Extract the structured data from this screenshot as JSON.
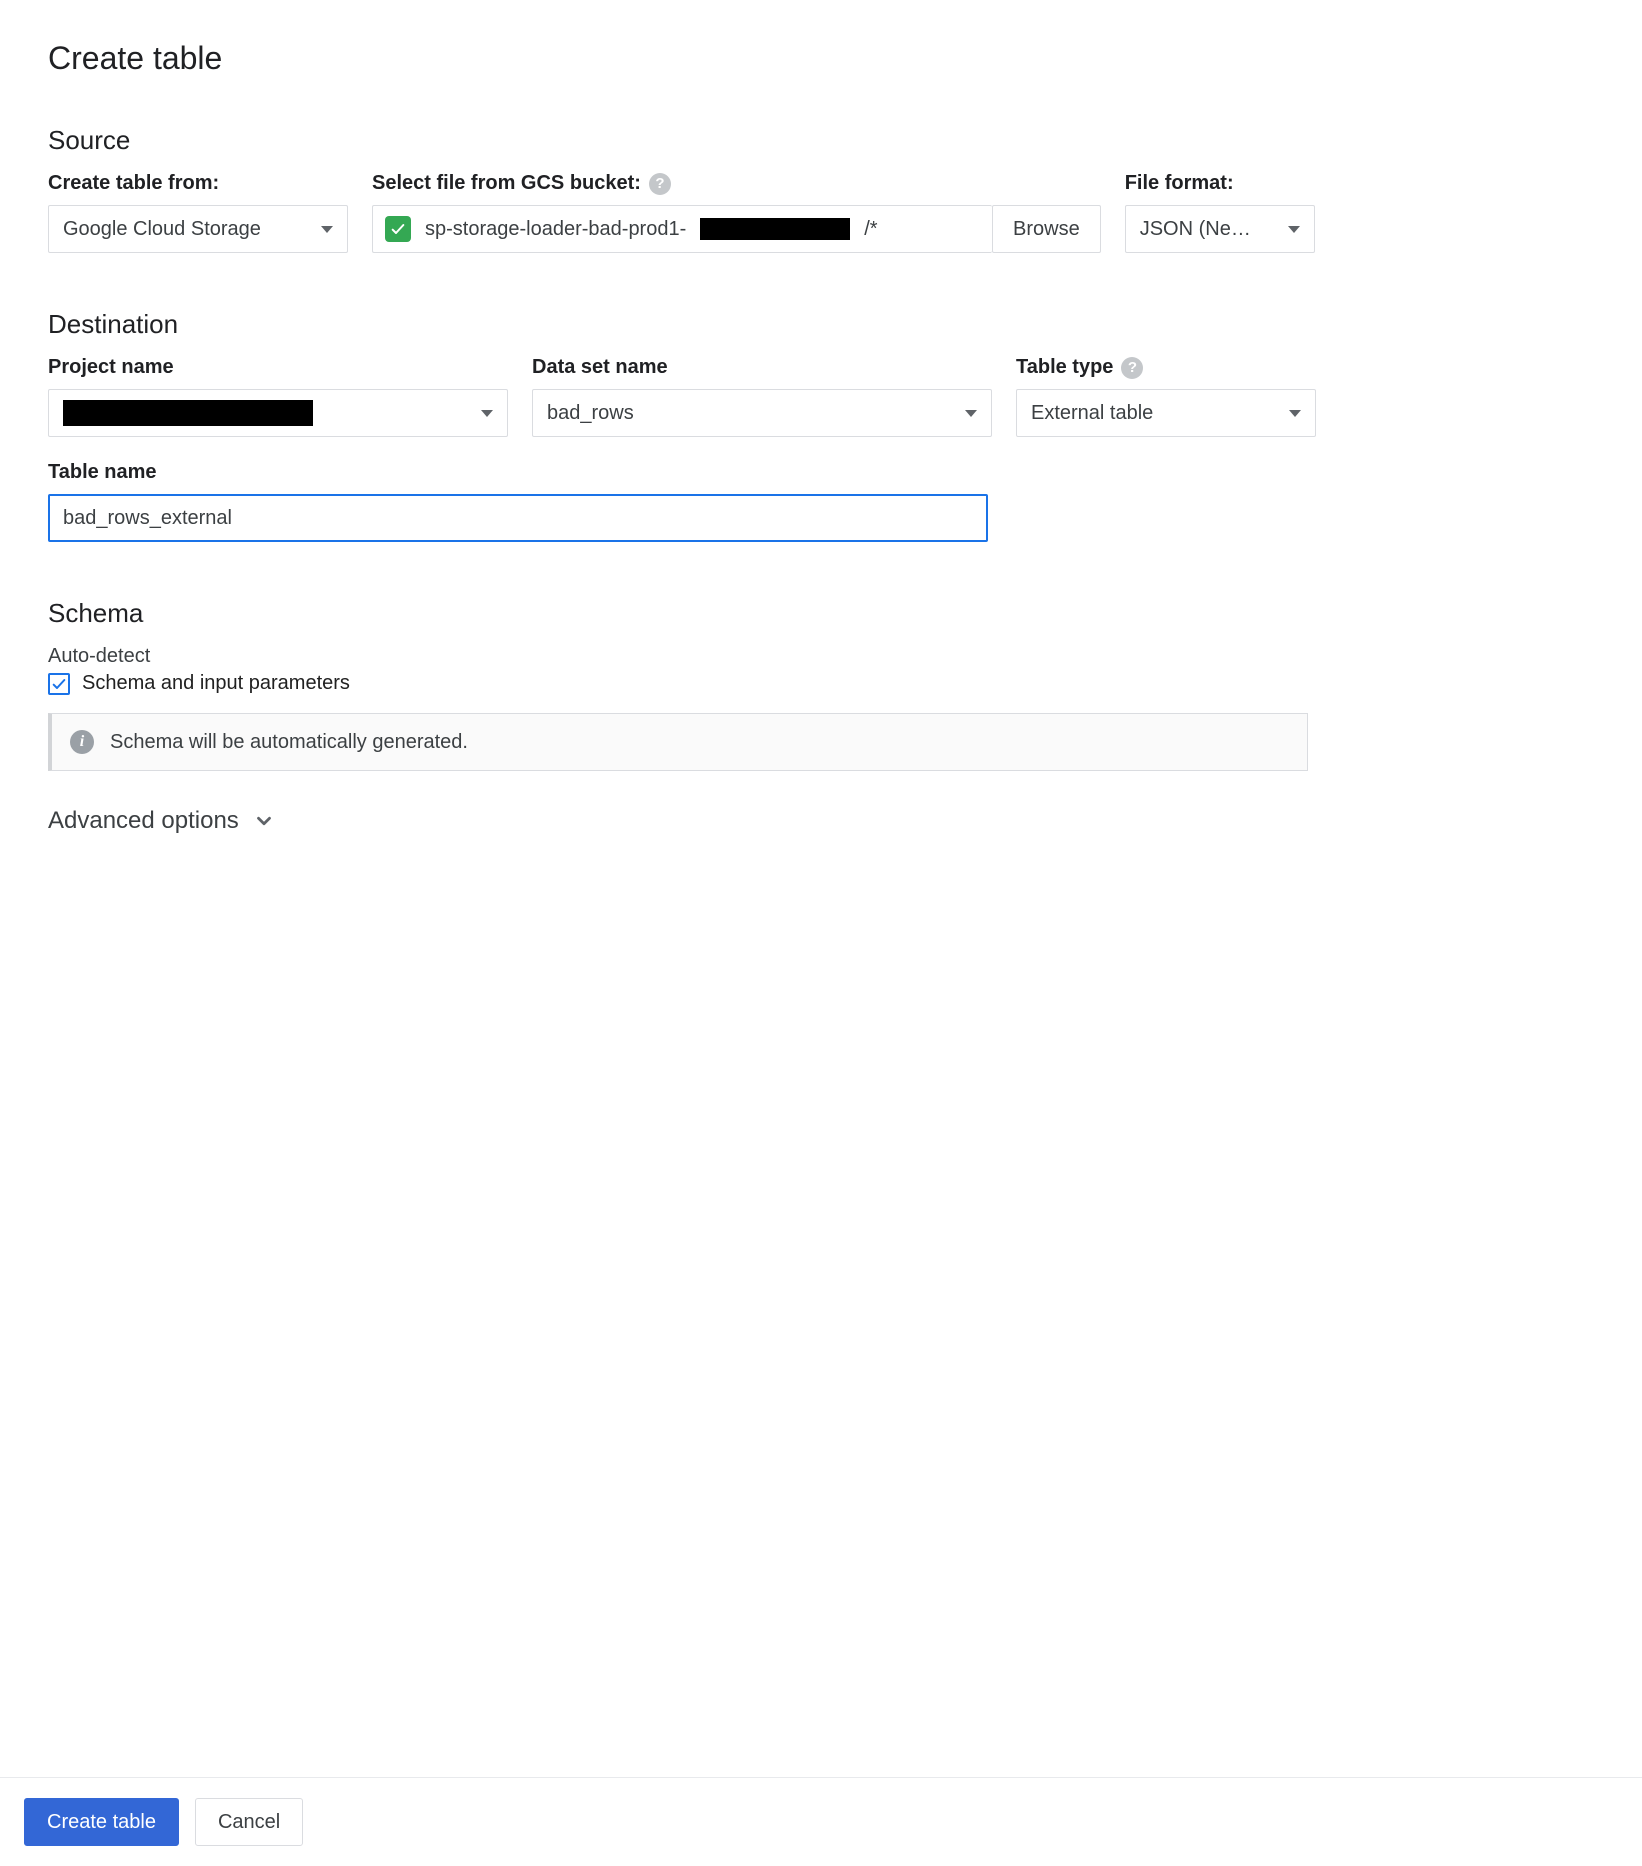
{
  "page_title": "Create table",
  "source": {
    "heading": "Source",
    "create_from_label": "Create table from:",
    "create_from_value": "Google Cloud Storage",
    "gcs_label": "Select file from GCS bucket:",
    "gcs_path_prefix": "sp-storage-loader-bad-prod1-",
    "gcs_path_suffix": "/*",
    "browse_label": "Browse",
    "file_format_label": "File format:",
    "file_format_value": "JSON (Ne…"
  },
  "destination": {
    "heading": "Destination",
    "project_label": "Project name",
    "project_value_redacted": true,
    "dataset_label": "Data set name",
    "dataset_value": "bad_rows",
    "table_type_label": "Table type",
    "table_type_value": "External table",
    "table_name_label": "Table name",
    "table_name_value": "bad_rows_external"
  },
  "schema": {
    "heading": "Schema",
    "auto_detect_label": "Auto-detect",
    "checkbox_label": "Schema and input parameters",
    "checkbox_checked": true,
    "info_text": "Schema will be automatically generated."
  },
  "advanced_label": "Advanced options",
  "footer": {
    "create_label": "Create table",
    "cancel_label": "Cancel"
  }
}
